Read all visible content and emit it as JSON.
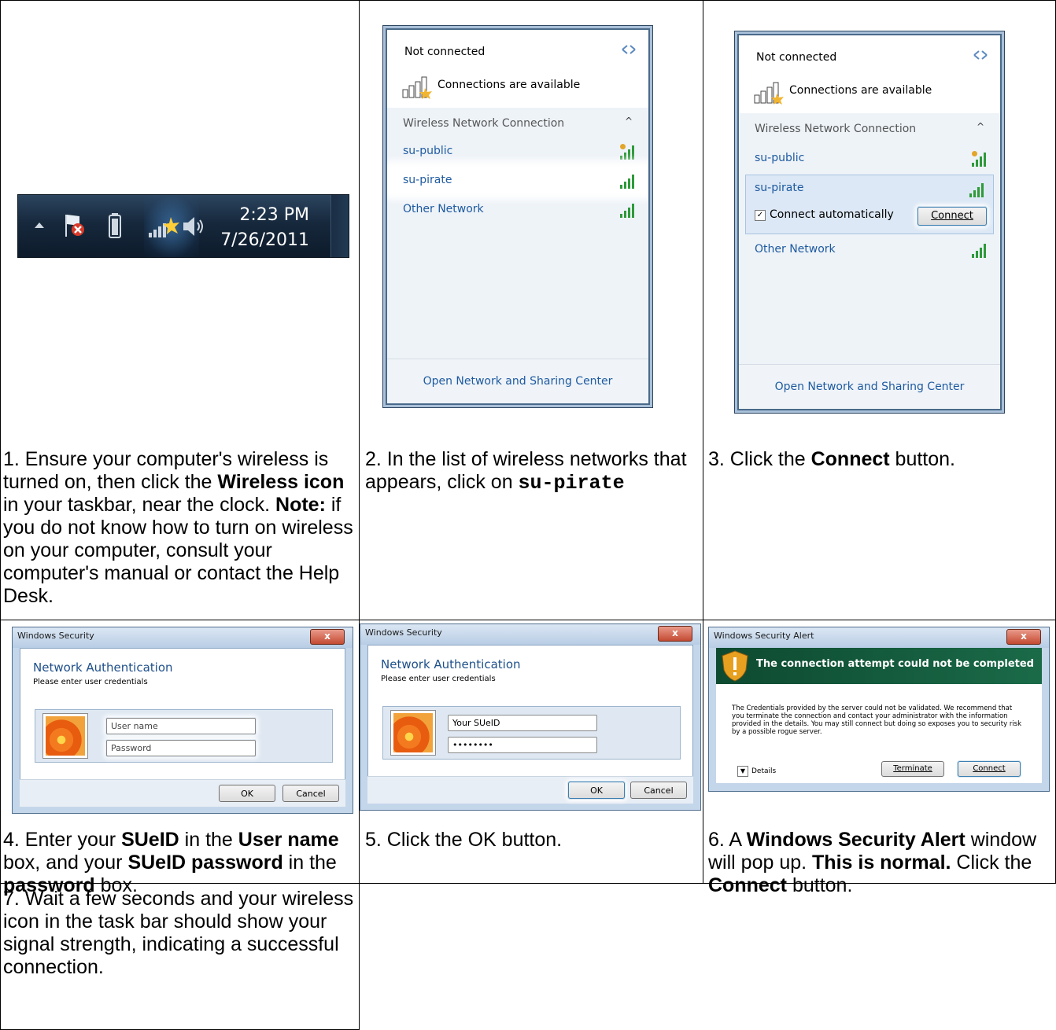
{
  "step1": {
    "caption_a": "1. Ensure your computer's wireless is turned on, then click the ",
    "caption_b": "Wireless icon",
    "caption_c": " in your taskbar, near the clock. ",
    "caption_d": "Note:",
    "caption_e": " if you do not know how to turn on wireless on your computer, consult your computer's manual or contact the Help Desk.",
    "taskbar": {
      "time": "2:23 PM",
      "date": "7/26/2011"
    }
  },
  "step2": {
    "caption_a": "2. In the list of wireless networks that appears, click on ",
    "caption_b": "su-pirate",
    "flyout": {
      "status": "Not connected",
      "available": "Connections are available",
      "section": "Wireless Network Connection",
      "networks": [
        "su-public",
        "su-pirate",
        "Other Network"
      ],
      "footer": "Open Network and Sharing Center"
    }
  },
  "step3": {
    "caption_a": "3. Click the ",
    "caption_b": "Connect",
    "caption_c": " button.",
    "flyout": {
      "status": "Not connected",
      "available": "Connections are available",
      "section": "Wireless Network Connection",
      "networks": [
        "su-public",
        "su-pirate",
        "Other Network"
      ],
      "auto_label": "Connect automatically",
      "connect_button": "Connect",
      "footer": "Open Network and Sharing Center"
    }
  },
  "step4": {
    "caption_a": "4. Enter your ",
    "caption_b": "SUeID",
    "caption_c": " in the ",
    "caption_d": "User name",
    "caption_e": " box, and your ",
    "caption_f": "SUeID password",
    "caption_g": " in the ",
    "caption_h": "password",
    "caption_i": " box.",
    "dialog": {
      "title": "Windows Security",
      "heading": "Network Authentication",
      "sub": "Please enter user credentials",
      "username_placeholder": "User name",
      "password_placeholder": "Password",
      "ok": "OK",
      "cancel": "Cancel"
    }
  },
  "step5": {
    "caption": "5. Click the OK button.",
    "dialog": {
      "title": "Windows Security",
      "heading": "Network Authentication",
      "sub": "Please enter user credentials",
      "username_value": "Your SUeID",
      "password_value": "••••••••",
      "ok": "OK",
      "cancel": "Cancel"
    }
  },
  "step6": {
    "caption_a": "6. A ",
    "caption_b": "Windows Security Alert",
    "caption_c": " window will pop up. ",
    "caption_d": "This is normal.",
    "caption_e": " Click the ",
    "caption_f": "Connect",
    "caption_g": " button.",
    "dialog": {
      "title": "Windows Security Alert",
      "heading": "The connection attempt could not be completed",
      "body": "The Credentials provided by the server could not be validated. We recommend that you terminate the connection and contact your administrator with the information provided in the details. You may still connect but doing so exposes you to security risk by a possible rogue server.",
      "details": "Details",
      "terminate": "Terminate",
      "connect": "Connect"
    }
  },
  "step7": {
    "caption": "7. Wait a few seconds and your wireless icon in the task bar should show your signal strength, indicating a successful connection."
  },
  "colors": {
    "link": "#1e5aa0",
    "signal": "#2e9a3a",
    "alert_header": "#0f5a3a",
    "taskbar": "#16283c"
  }
}
